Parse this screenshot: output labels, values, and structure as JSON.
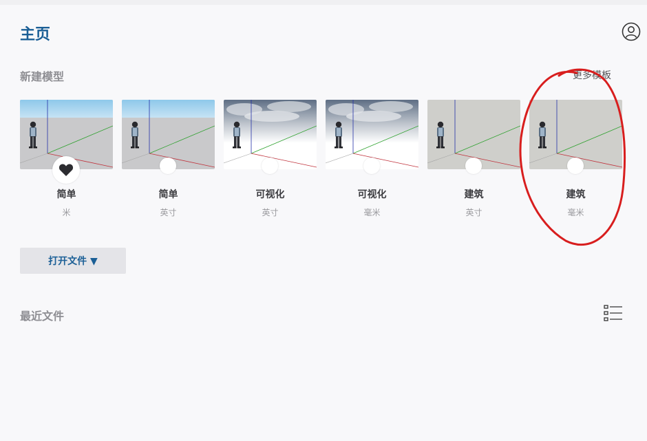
{
  "header": {
    "title": "主页",
    "account_icon": "user-circle-icon"
  },
  "new_model": {
    "label": "新建模型",
    "more_link": "更多模板",
    "templates": [
      {
        "name": "简单",
        "unit": "米",
        "style": "simple",
        "favorite": true
      },
      {
        "name": "简单",
        "unit": "英寸",
        "style": "simple",
        "favorite": false
      },
      {
        "name": "可视化",
        "unit": "英寸",
        "style": "visual",
        "favorite": false
      },
      {
        "name": "可视化",
        "unit": "毫米",
        "style": "visual",
        "favorite": false
      },
      {
        "name": "建筑",
        "unit": "英寸",
        "style": "arch",
        "favorite": false
      },
      {
        "name": "建筑",
        "unit": "毫米",
        "style": "arch",
        "favorite": false
      }
    ]
  },
  "open_file": {
    "label": "打开文件 ▼"
  },
  "recent": {
    "label": "最近文件",
    "view_icon": "list-view-icon"
  },
  "colors": {
    "accent": "#1b5f96",
    "annotation": "#d81e1e"
  }
}
